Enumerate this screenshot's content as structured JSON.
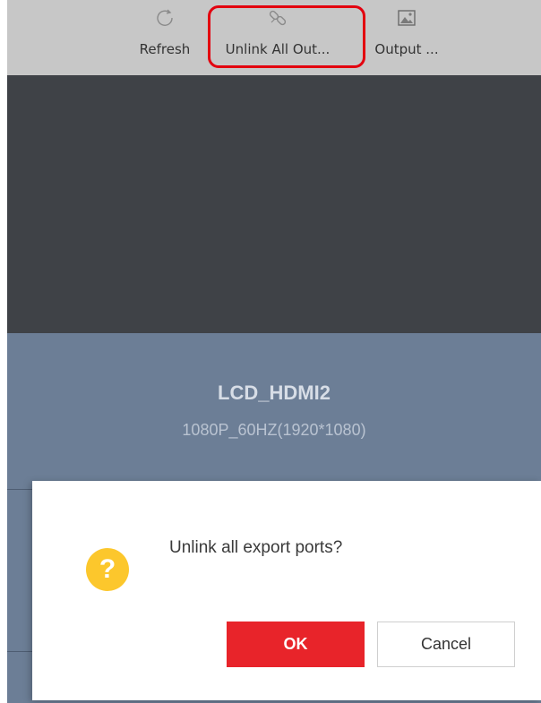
{
  "toolbar": {
    "refresh": {
      "label": "Refresh",
      "icon": "refresh-icon"
    },
    "unlink_all": {
      "label": "Unlink All Out...",
      "icon": "unlink-icon"
    },
    "output": {
      "label": "Output ...",
      "icon": "image-icon"
    },
    "highlight_color": "#e3000f"
  },
  "screen": {
    "name": "LCD_HDMI2",
    "resolution": "1080P_60HZ(1920*1080)"
  },
  "dialog": {
    "icon": "question-icon",
    "icon_glyph": "?",
    "message": "Unlink all export ports?",
    "ok_label": "OK",
    "cancel_label": "Cancel",
    "ok_color": "#e8242a",
    "icon_color": "#fcc72c"
  }
}
